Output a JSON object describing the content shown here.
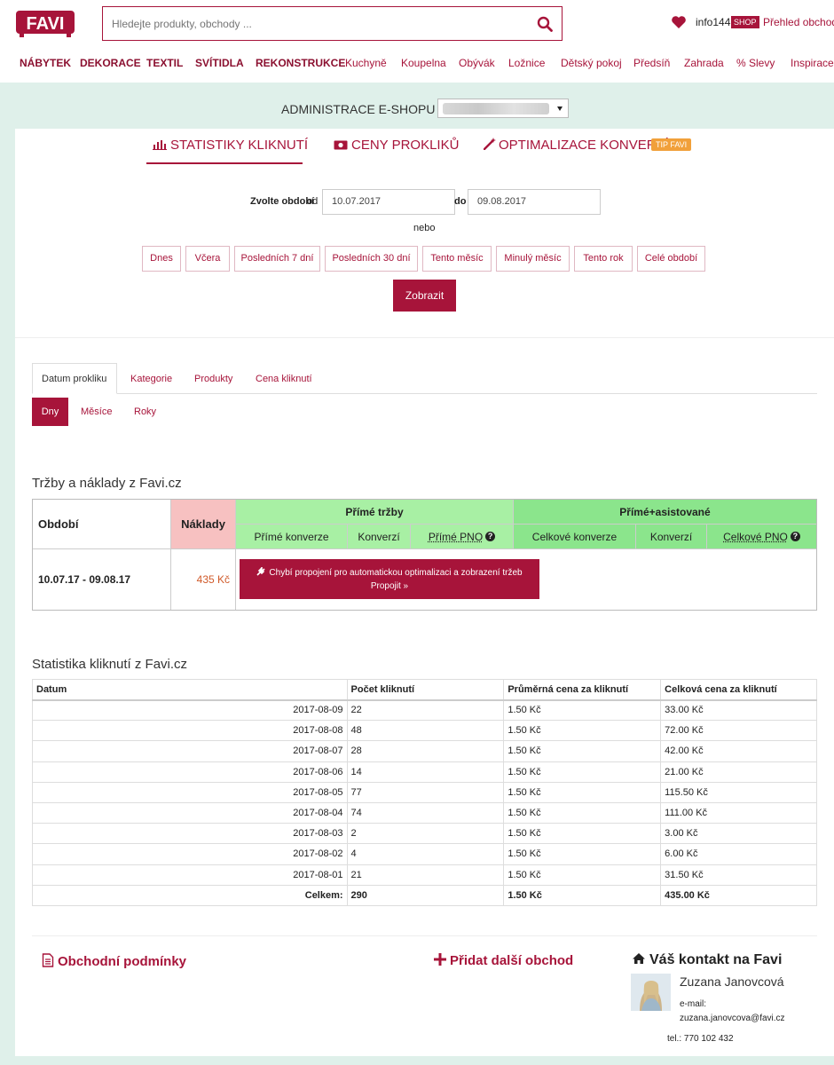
{
  "header": {
    "search_placeholder": "Hledejte produkty, obchody ...",
    "user": "info144",
    "shop_badge": "SHOP",
    "overview_link": "Přehled obchodu",
    "brand_color": "#a7143a"
  },
  "nav": [
    "NÁBYTEK",
    "DEKORACE",
    "TEXTIL",
    "SVÍTIDLA",
    "REKONSTRUKCE",
    "Kuchyně",
    "Koupelna",
    "Obývák",
    "Ložnice",
    "Dětský pokoj",
    "Předsíň",
    "Zahrada",
    "% Slevy",
    "Inspirace"
  ],
  "admin": {
    "title": "ADMINISTRACE E-SHOPU"
  },
  "tabs": [
    "STATISTIKY KLIKNUTÍ",
    "CENY PROKLIKŮ",
    "OPTIMALIZACE KONVERZÍ"
  ],
  "tip_badge": "TIP FAVI",
  "period": {
    "label": "Zvolte období",
    "from_word": "od",
    "to_word": "do",
    "from": "10.07.2017",
    "to": "09.08.2017",
    "or": "nebo",
    "ranges": [
      "Dnes",
      "Včera",
      "Posledních 7 dní",
      "Posledních 30 dní",
      "Tento měsíc",
      "Minulý měsíc",
      "Tento rok",
      "Celé období"
    ],
    "show": "Zobrazit"
  },
  "subtabs": [
    "Datum prokliku",
    "Kategorie",
    "Produkty",
    "Cena kliknutí"
  ],
  "granularity": [
    "Dny",
    "Měsíce",
    "Roky"
  ],
  "revenue": {
    "title": "Tržby a náklady z Favi.cz",
    "col_period": "Období",
    "col_costs": "Náklady",
    "group_direct": "Přímé tržby",
    "group_total": "Přímé+asistované",
    "sub": [
      "Přímé konverze",
      "Konverzí",
      "Přímé PNO",
      "Celkové konverze",
      "Konverzí",
      "Celkové PNO"
    ],
    "row_period": "10.07.17 - 09.08.17",
    "row_costs": "435 Kč",
    "alert_text": "Chybí propojení pro automatickou optimalizaci a zobrazení tržeb",
    "alert_link": "Propojit »"
  },
  "stats": {
    "title": "Statistika kliknutí z Favi.cz",
    "headers": [
      "Datum",
      "Počet kliknutí",
      "Průměrná cena za kliknutí",
      "Celková cena za kliknutí"
    ],
    "rows": [
      [
        "2017-08-09",
        "22",
        "1.50 Kč",
        "33.00 Kč"
      ],
      [
        "2017-08-08",
        "48",
        "1.50 Kč",
        "72.00 Kč"
      ],
      [
        "2017-08-07",
        "28",
        "1.50 Kč",
        "42.00 Kč"
      ],
      [
        "2017-08-06",
        "14",
        "1.50 Kč",
        "21.00 Kč"
      ],
      [
        "2017-08-05",
        "77",
        "1.50 Kč",
        "115.50 Kč"
      ],
      [
        "2017-08-04",
        "74",
        "1.50 Kč",
        "111.00 Kč"
      ],
      [
        "2017-08-03",
        "2",
        "1.50 Kč",
        "3.00 Kč"
      ],
      [
        "2017-08-02",
        "4",
        "1.50 Kč",
        "6.00 Kč"
      ],
      [
        "2017-08-01",
        "21",
        "1.50 Kč",
        "31.50 Kč"
      ]
    ],
    "total": [
      "Celkem:",
      "290",
      "1.50 Kč",
      "435.00 Kč"
    ]
  },
  "footer": {
    "terms": "Obchodní podmínky",
    "add_shop": "Přidat další obchod",
    "contact_title": "Váš kontakt na Favi",
    "contact_name": "Zuzana Janovcová",
    "email_label": "e-mail:",
    "email": "zuzana.janovcova@favi.cz",
    "phone": "tel.: 770 102 432"
  }
}
